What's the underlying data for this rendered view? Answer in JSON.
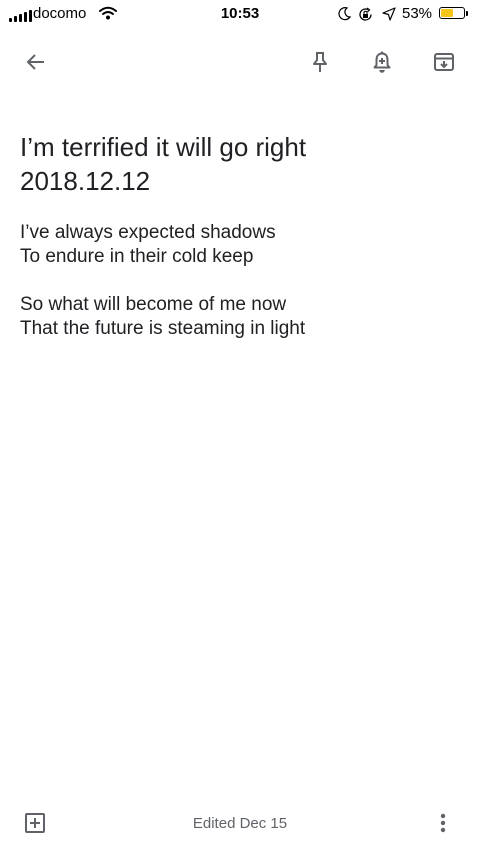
{
  "status_bar": {
    "carrier": "docomo",
    "time": "10:53",
    "battery_percent": "53%",
    "battery_level": 0.53,
    "battery_color": "#f5c518",
    "icons": [
      "signal-bars-icon",
      "wifi-icon",
      "moon-icon",
      "rotation-lock-icon",
      "location-arrow-icon",
      "battery-icon"
    ]
  },
  "toolbar": {
    "icons": [
      "back-arrow-icon",
      "pin-icon",
      "add-reminder-icon",
      "archive-icon"
    ]
  },
  "note": {
    "title_lines": [
      "I’m terrified it will go right",
      "2018.12.12"
    ],
    "body": {
      "stanza1": [
        "I’ve always expected shadows",
        "To endure in their cold keep"
      ],
      "stanza2": [
        "So what will become of me now",
        "That the future is steaming in light"
      ]
    }
  },
  "bottom_bar": {
    "edited_label": "Edited Dec 15",
    "icons": [
      "add-box-icon",
      "more-vert-icon"
    ]
  },
  "colors": {
    "text_primary": "#202124",
    "text_secondary": "#5f6368",
    "icon": "#5f6368"
  }
}
